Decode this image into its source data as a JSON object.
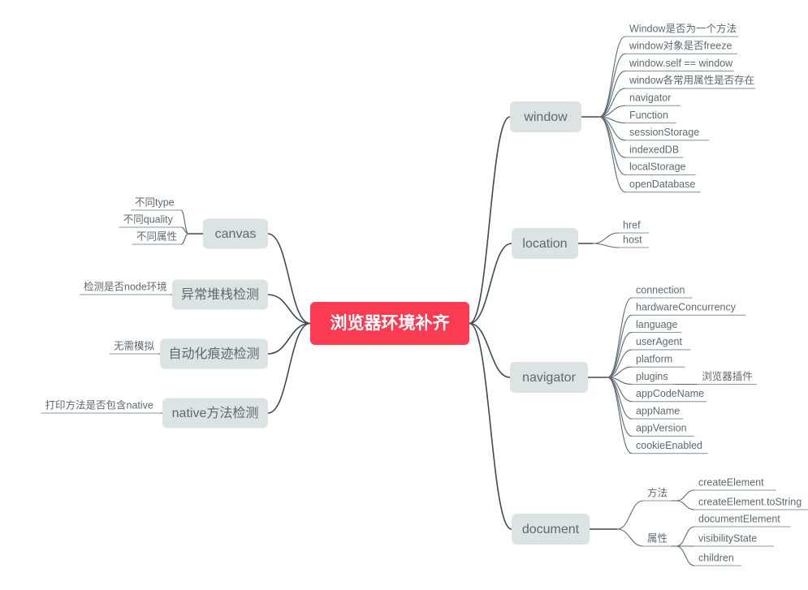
{
  "colors": {
    "root_fill": "#fb3b51",
    "root_text": "#ffffff",
    "node_fill": "#dbe3e3",
    "node_text": "#5d6a72",
    "branch_stroke": "#3d4a54",
    "twig_stroke": "#5c6b77",
    "underline": "#8b9aa3",
    "background": "#ffffff"
  },
  "root": {
    "label": "浏览器环境补齐"
  },
  "right_branches": [
    {
      "label": "window",
      "children": [
        {
          "label": "Window是否为一个方法"
        },
        {
          "label": "window对象是否freeze"
        },
        {
          "label": "window.self == window"
        },
        {
          "label": "window各常用属性是否存在"
        },
        {
          "label": "navigator"
        },
        {
          "label": "Function"
        },
        {
          "label": "sessionStorage"
        },
        {
          "label": "indexedDB"
        },
        {
          "label": "localStorage"
        },
        {
          "label": "openDatabase"
        }
      ]
    },
    {
      "label": "location",
      "children": [
        {
          "label": "href"
        },
        {
          "label": "host"
        }
      ]
    },
    {
      "label": "navigator",
      "children": [
        {
          "label": "connection"
        },
        {
          "label": "hardwareConcurrency"
        },
        {
          "label": "language"
        },
        {
          "label": "userAgent"
        },
        {
          "label": "platform"
        },
        {
          "label": "plugins",
          "children": [
            {
              "label": "浏览器插件"
            }
          ]
        },
        {
          "label": "appCodeName"
        },
        {
          "label": "appName"
        },
        {
          "label": "appVersion"
        },
        {
          "label": "cookieEnabled"
        }
      ]
    },
    {
      "label": "document",
      "children": [
        {
          "label": "方法",
          "children": [
            {
              "label": "createElement"
            },
            {
              "label": "createElement.toString"
            }
          ]
        },
        {
          "label": "属性",
          "children": [
            {
              "label": "documentElement"
            },
            {
              "label": "visibilityState"
            },
            {
              "label": "children"
            }
          ]
        }
      ]
    }
  ],
  "left_branches": [
    {
      "label": "canvas",
      "children": [
        {
          "label": "不同type"
        },
        {
          "label": "不同quality"
        },
        {
          "label": "不同属性"
        }
      ]
    },
    {
      "label": "异常堆栈检测",
      "children": [
        {
          "label": "检测是否node环境"
        }
      ]
    },
    {
      "label": "自动化痕迹检测",
      "children": [
        {
          "label": "无需模拟"
        }
      ]
    },
    {
      "label": "native方法检测",
      "children": [
        {
          "label": "打印方法是否包含native"
        }
      ]
    }
  ]
}
